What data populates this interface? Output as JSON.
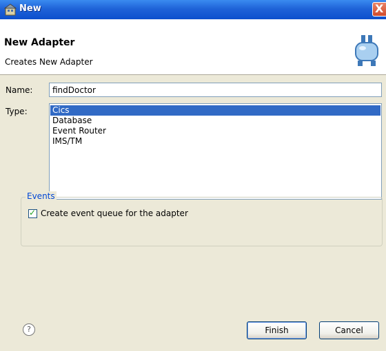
{
  "window": {
    "title": "New",
    "close_glyph": "X"
  },
  "header": {
    "title": "New Adapter",
    "subtitle": "Creates New Adapter",
    "icon": "adapter-icon"
  },
  "form": {
    "name_label": "Name:",
    "name_value": "findDoctor",
    "type_label": "Type:",
    "types": [
      "Cics",
      "Database",
      "Event Router",
      "IMS/TM"
    ],
    "selected_type": "Cics"
  },
  "events": {
    "group_label": "Events",
    "checkbox_label": "Create event queue for the adapter",
    "checked": true
  },
  "footer": {
    "help_icon": "help-icon",
    "finish_label": "Finish",
    "cancel_label": "Cancel"
  }
}
